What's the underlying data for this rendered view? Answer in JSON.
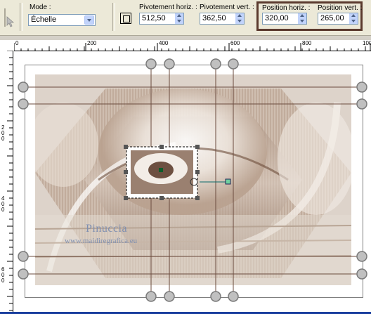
{
  "toolbar": {
    "mode_label": "Mode :",
    "mode_value": "Échelle",
    "pivot_h_label": "Pivotement horiz. :",
    "pivot_h_value": "512,50",
    "pivot_v_label": "Pivotement vert. :",
    "pivot_v_value": "362,50",
    "pos_h_label": "Position horiz. :",
    "pos_h_value": "320,00",
    "pos_v_label": "Position vert. :",
    "pos_v_value": "265,00"
  },
  "ruler": {
    "top": [
      "0",
      "200",
      "400",
      "600",
      "800",
      "100"
    ],
    "left": [
      "200",
      "400",
      "600"
    ]
  },
  "watermark": {
    "line1": "Pinuccia",
    "line2": "www.maidiregrafica.eu"
  },
  "colors": {
    "highlight_border": "#5b3a2e",
    "handle_fill": "#c0c0c0",
    "guide_line": "#6b4b3e"
  }
}
